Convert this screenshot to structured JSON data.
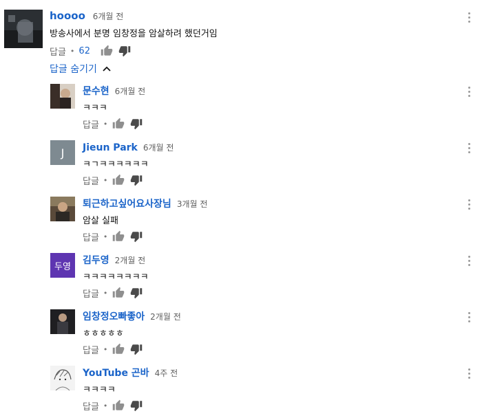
{
  "top_comment": {
    "author": "hoooo",
    "time": "6개월 전",
    "text": "방송사에서 분명 임창정을 암살하려 했던거임",
    "reply_label": "답글",
    "dot": "•",
    "like_count": "62"
  },
  "hide_replies_label": "답글 숨기기",
  "replies": [
    {
      "author": "문수현",
      "time": "6개월 전",
      "text": "ㅋㅋㅋ",
      "reply_label": "답글",
      "dot": "•",
      "avatar_text": ""
    },
    {
      "author": "Jieun Park",
      "time": "6개월 전",
      "text": "ㅋㄱㅋㅋㅋㅋㅋㅋ",
      "reply_label": "답글",
      "dot": "•",
      "avatar_text": "J",
      "avatar_color": "#7e8a91"
    },
    {
      "author": "퇴근하고싶어요사장님",
      "time": "3개월 전",
      "text": "암살 실패",
      "reply_label": "답글",
      "dot": "•",
      "avatar_text": ""
    },
    {
      "author": "김두영",
      "time": "2개월 전",
      "text": "ㅋㅋㅋㅋㅋㅋㅋㅋ",
      "reply_label": "답글",
      "dot": "•",
      "avatar_text": "두영",
      "avatar_color": "#5e35b1"
    },
    {
      "author": "임창정오빠좋아",
      "time": "2개월 전",
      "text": "ㅎㅎㅎㅎㅎ",
      "reply_label": "답글",
      "dot": "•",
      "avatar_text": ""
    },
    {
      "author": "YouTube 곤바",
      "time": "4주 전",
      "text": "ㅋㅋㅋㅋ",
      "reply_label": "답글",
      "dot": "•",
      "avatar_text": ""
    }
  ],
  "icons": {
    "like": "thumb-up-icon",
    "dislike": "thumb-down-icon",
    "menu": "more-vertical-icon",
    "chevron": "chevron-up-icon"
  },
  "colors": {
    "link": "#1b64c9",
    "meta": "#5f5f5f"
  }
}
